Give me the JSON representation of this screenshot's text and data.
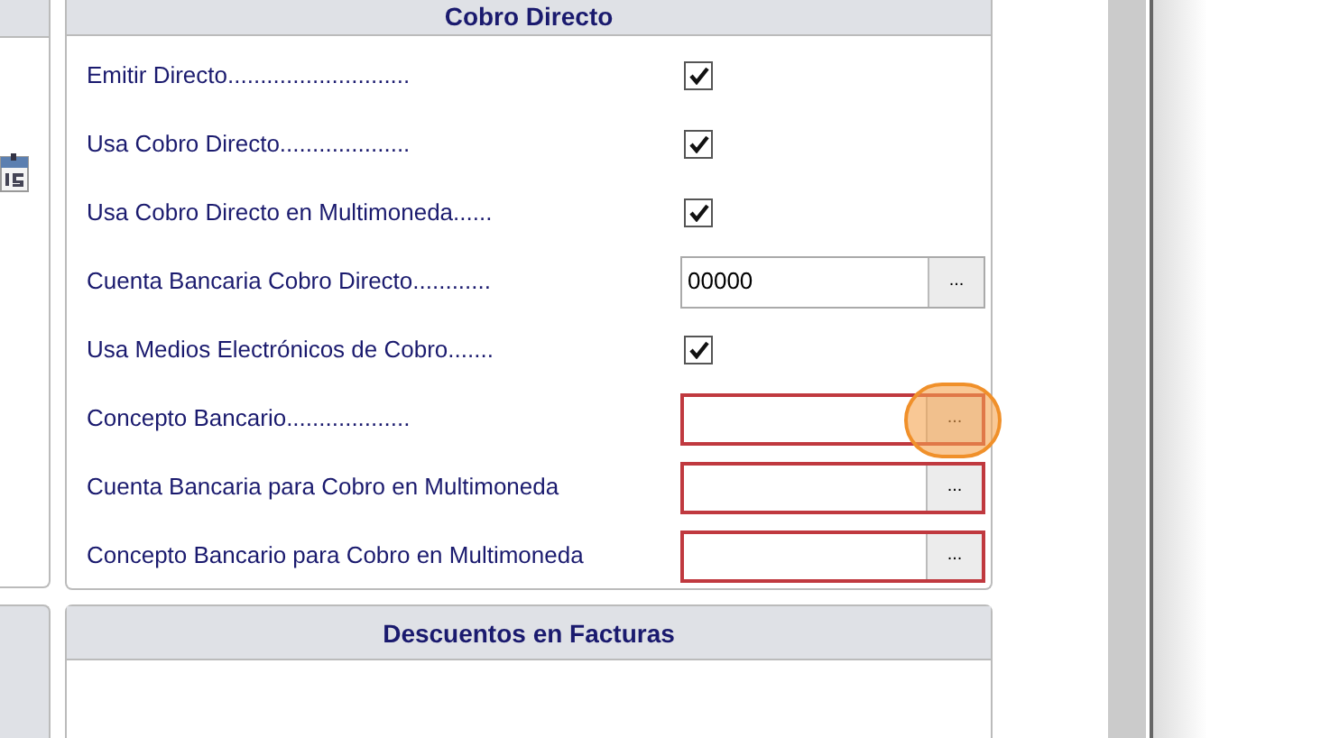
{
  "panel": {
    "title": "Cobro Directo",
    "rows": [
      {
        "kind": "checkbox",
        "label": "Emitir Directo............................",
        "checked": true
      },
      {
        "kind": "checkbox",
        "label": "Usa Cobro Directo....................",
        "checked": true
      },
      {
        "kind": "checkbox",
        "label": "Usa Cobro Directo en Multimoneda......",
        "checked": true
      },
      {
        "kind": "lookup",
        "label": "Cuenta Bancaria Cobro Directo............",
        "value": "00000",
        "button": "...",
        "invalid": false,
        "clicked": false
      },
      {
        "kind": "checkbox",
        "label": "Usa Medios Electrónicos de Cobro.......",
        "checked": true
      },
      {
        "kind": "lookup",
        "label": "Concepto Bancario...................",
        "value": "",
        "button": "...",
        "invalid": true,
        "clicked": true
      },
      {
        "kind": "lookup",
        "label": "Cuenta Bancaria para Cobro en Multimoneda",
        "value": "",
        "button": "...",
        "invalid": true,
        "clicked": false
      },
      {
        "kind": "lookup",
        "label": "Concepto Bancario para Cobro en Multimoneda",
        "value": "",
        "button": "...",
        "invalid": true,
        "clicked": false
      }
    ]
  },
  "bottom_panel": {
    "title": "Descuentos en Facturas"
  }
}
